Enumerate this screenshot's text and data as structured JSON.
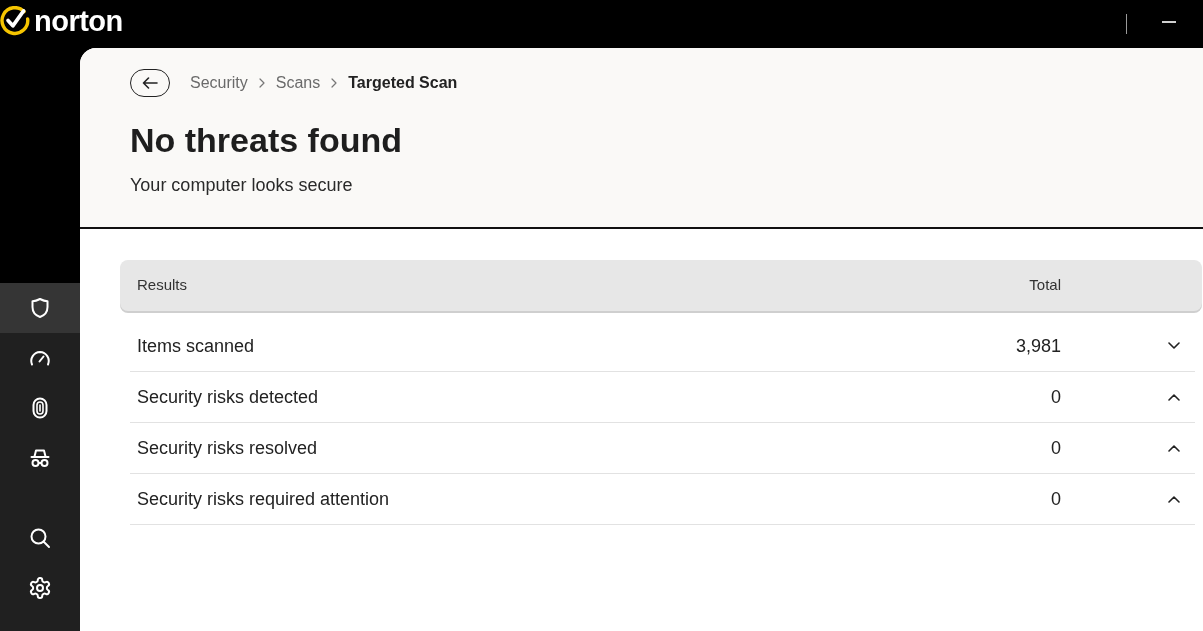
{
  "app_bar": {
    "logo_text": "norton"
  },
  "sidebar": {
    "items": [
      {
        "kind": "shield",
        "selected": true
      },
      {
        "kind": "gauge",
        "selected": false
      },
      {
        "kind": "fingerprint",
        "selected": false
      },
      {
        "kind": "incognito",
        "selected": false
      }
    ],
    "footer_items": [
      {
        "kind": "search",
        "selected": false
      },
      {
        "kind": "settings",
        "selected": false
      }
    ]
  },
  "breadcrumb": [
    {
      "label": "Security",
      "current": false
    },
    {
      "label": "Scans",
      "current": false
    },
    {
      "label": "Targeted Scan",
      "current": true
    }
  ],
  "heading": {
    "title": "No threats found",
    "subtitle": "Your computer looks secure"
  },
  "results_table": {
    "columns": [
      "Results",
      "Total"
    ],
    "rows": [
      {
        "label": "Items scanned",
        "total": "3,981",
        "expanded": false
      },
      {
        "label": "Security risks detected",
        "total": "0",
        "expanded": true
      },
      {
        "label": "Security risks resolved",
        "total": "0",
        "expanded": true
      },
      {
        "label": "Security risks required attention",
        "total": "0",
        "expanded": true
      }
    ]
  }
}
